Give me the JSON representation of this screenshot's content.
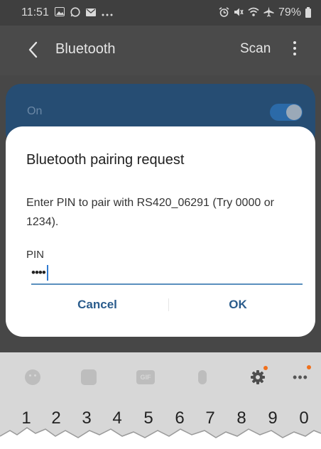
{
  "status_bar": {
    "time": "11:51",
    "left_icons": [
      "gallery-icon",
      "whatsapp-icon",
      "mail-icon",
      "more-notifications-icon"
    ],
    "right_icons": [
      "alarm-icon",
      "mute-icon",
      "wifi-icon",
      "airplane-icon"
    ],
    "battery": "79%"
  },
  "app_bar": {
    "title": "Bluetooth",
    "scan_label": "Scan"
  },
  "bluetooth_toggle": {
    "label": "On",
    "state": true,
    "accent": "#2b6aa8"
  },
  "dialog": {
    "title": "Bluetooth pairing request",
    "message": "Enter PIN to pair with RS420_06291 (Try 0000 or 1234).",
    "pin_label": "PIN",
    "pin_value": "••••",
    "cancel_label": "Cancel",
    "ok_label": "OK",
    "button_color": "#2a5c8c",
    "input_underline_color": "#5a8fbe"
  },
  "keyboard": {
    "tools": [
      "emoji-icon",
      "sticker-icon",
      "gif-icon",
      "mic-icon",
      "gear-icon",
      "ellipsis-icon"
    ],
    "gif_label": "GIF",
    "number_keys": [
      "1",
      "2",
      "3",
      "4",
      "5",
      "6",
      "7",
      "8",
      "9",
      "0"
    ]
  }
}
